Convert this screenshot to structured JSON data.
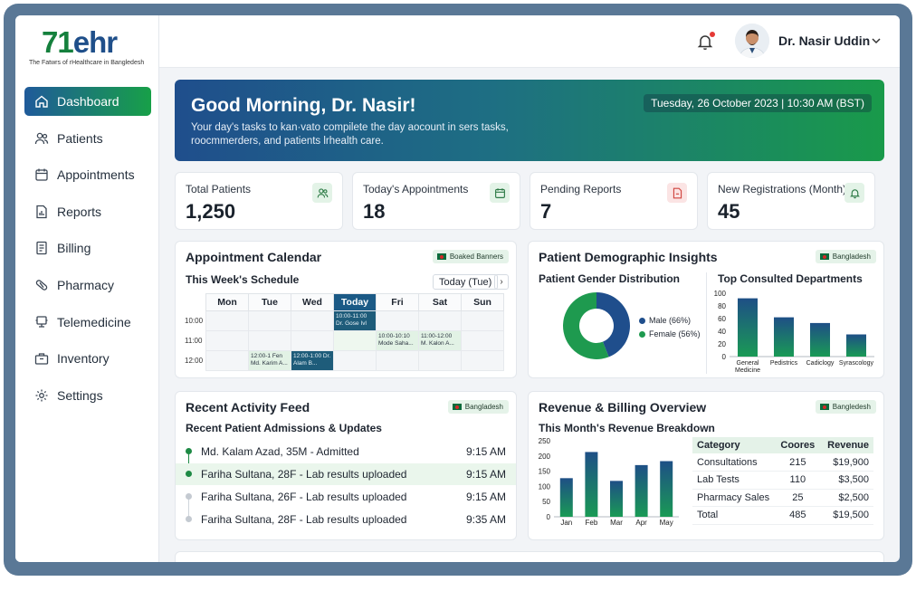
{
  "brand": {
    "logo_prefix": "71",
    "logo_suffix": "ehr",
    "tagline": "The Fatwrs of rHealthcare in Bangledesh"
  },
  "sidebar": {
    "items": [
      {
        "label": "Dashboard",
        "icon": "home-icon",
        "active": true
      },
      {
        "label": "Patients",
        "icon": "users-icon"
      },
      {
        "label": "Appointments",
        "icon": "calendar-icon"
      },
      {
        "label": "Reports",
        "icon": "report-icon"
      },
      {
        "label": "Billing",
        "icon": "billing-icon"
      },
      {
        "label": "Pharmacy",
        "icon": "pill-icon"
      },
      {
        "label": "Telemedicine",
        "icon": "telemedicine-icon"
      },
      {
        "label": "Inventory",
        "icon": "inventory-icon"
      },
      {
        "label": "Settings",
        "icon": "gear-icon"
      }
    ]
  },
  "topbar": {
    "user_name": "Dr. Nasir Uddin",
    "notification_icon": "bell-icon"
  },
  "hero": {
    "greeting": "Good Morning, Dr. Nasir!",
    "subtitle": "Your day's tasks to kan·vato compilete the day aocount in sers tasks, roocmmerders, and patients lrhealth care.",
    "datetime": "Tuesday, 26 October 2023 | 10:30 AM (BST)"
  },
  "stats": [
    {
      "label": "Total Patients",
      "value": "1,250",
      "icon": "users-icon",
      "color": "#e3f3e7"
    },
    {
      "label": "Today's Appointments",
      "value": "18",
      "icon": "calendar-icon",
      "color": "#e3f3e7"
    },
    {
      "label": "Pending Reports",
      "value": "7",
      "icon": "file-icon",
      "color": "#fbe4e4"
    },
    {
      "label": "New Registrations (Month)",
      "value": "45",
      "icon": "bell-icon",
      "color": "#e3f3e7"
    }
  ],
  "calendar": {
    "title": "Appointment Calendar",
    "tag": "Boaked Banners",
    "subtitle": "This Week's Schedule",
    "today_button": "Today (Tue)",
    "next_button": "›",
    "days": [
      "Mon",
      "Tue",
      "Wed",
      "Today",
      "Fri",
      "Sat",
      "Sun"
    ],
    "times": [
      "10:00",
      "11:00",
      "12:00"
    ],
    "events": {
      "today_10": "10:00-11:00 Dr. Gose Ivl",
      "fri_11": "10:00-10:10 Mode Saha...",
      "sat_11": "11:00-12:00 M. Kalon A...",
      "tue_12": "12:00-1 Fen Md. Karim A...",
      "wed_12": "12:00-1:00 Dr. Alam B..."
    }
  },
  "demographics": {
    "title": "Patient Demographic Insights",
    "tag": "Bangladesh",
    "gender_title": "Patient Gender Distribution",
    "male_label": "Male (66%)",
    "female_label": "Female (56%)",
    "male_pct": 0.44,
    "male_color": "#1f4e8c",
    "female_color": "#1e9a4f",
    "dept_title": "Top Consulted Departments"
  },
  "activity": {
    "title": "Recent Activity Feed",
    "tag": "Bangladesh",
    "subtitle": "Recent Patient Admissions & Updates",
    "items": [
      {
        "text": "Md. Kalam Azad, 35M - Admitted",
        "time": "9:15 AM"
      },
      {
        "text": "Fariha Sultana, 28F - Lab results uploaded",
        "time": "9:15 AM"
      },
      {
        "text": "Fariha Sultana, 26F - Lab results uploaded",
        "time": "9:15 AM"
      },
      {
        "text": "Fariha Sultana, 28F - Lab results uploaded",
        "time": "9:35 AM"
      }
    ]
  },
  "revenue": {
    "title": "Revenue & Billing Overview",
    "tag": "Bangledesh",
    "subtitle": "This Month's Revenue Breakdown",
    "table": {
      "headers": [
        "Category",
        "Coores",
        "Revenue"
      ],
      "rows": [
        [
          "Consultations",
          "215",
          "$19,900"
        ],
        [
          "Lab Tests",
          "110",
          "$3,500"
        ],
        [
          "Pharmacy Sales",
          "25",
          "$2,500"
        ],
        [
          "Total",
          "485",
          "$19,500"
        ]
      ]
    }
  },
  "chart_data": [
    {
      "type": "bar",
      "title": "Top Consulted Departments",
      "categories": [
        "General Medicine",
        "Pedistrics",
        "Cadiclogy",
        "Syrascology"
      ],
      "category_lines": [
        [
          "General",
          "Medicine"
        ],
        [
          "Pedistrics"
        ],
        [
          "Cadiclogy"
        ],
        [
          "Syrascology"
        ]
      ],
      "values": [
        92,
        62,
        53,
        35
      ],
      "ylim": [
        0,
        100
      ],
      "yticks": [
        0,
        20,
        40,
        60,
        80,
        100
      ]
    },
    {
      "type": "bar",
      "title": "This Month's Revenue Breakdown",
      "categories": [
        "Jan",
        "Feb",
        "Mar",
        "Apr",
        "May"
      ],
      "values": [
        127,
        213,
        118,
        170,
        183
      ],
      "ylim": [
        0,
        250
      ],
      "yticks": [
        0,
        50,
        100,
        150,
        200,
        250
      ]
    },
    {
      "type": "pie",
      "title": "Patient Gender Distribution",
      "categories": [
        "Male (66%)",
        "Female (56%)"
      ],
      "values": [
        44,
        56
      ]
    }
  ]
}
